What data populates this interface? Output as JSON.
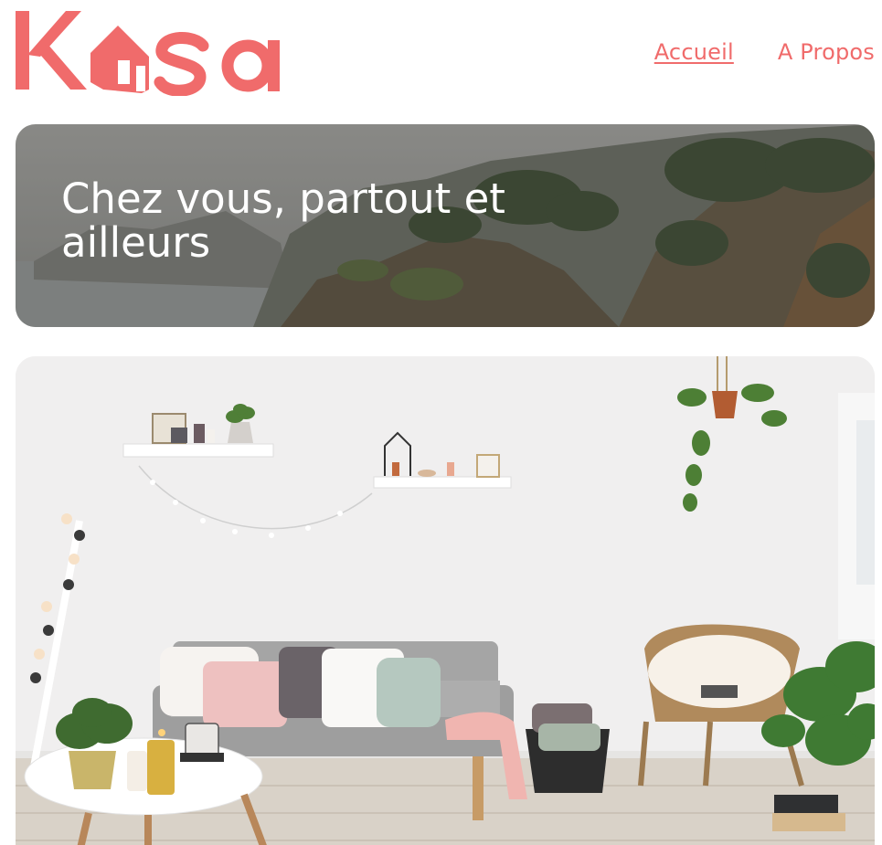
{
  "header": {
    "logo_text": "Kasa",
    "nav": [
      {
        "label": "Accueil",
        "active": true
      },
      {
        "label": "A Propos",
        "active": false
      }
    ]
  },
  "banner": {
    "title": "Chez vous, partout et ailleurs"
  },
  "colors": {
    "brand": "#FF6060",
    "nav_text": "#F06B6B",
    "banner_text": "#ffffff"
  }
}
